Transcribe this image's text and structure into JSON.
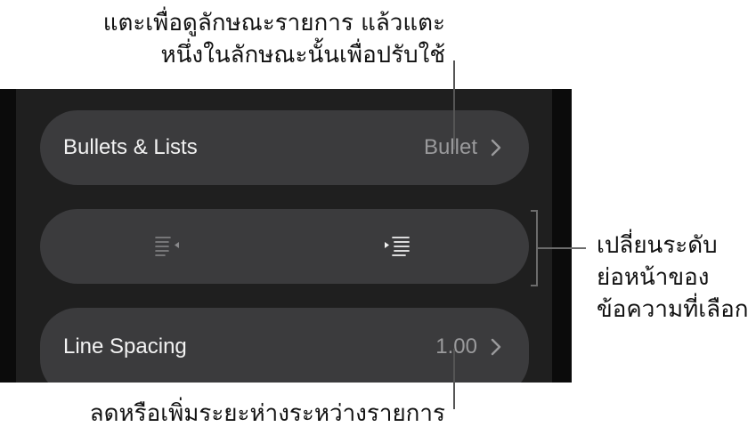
{
  "callouts": {
    "top": [
      "แตะเพื่อดูลักษณะรายการ แล้วแตะ",
      "หนึ่งในลักษณะนั้นเพื่อปรับใช้"
    ],
    "right": [
      "เปลี่ยนระดับ",
      "ย่อหน้าของ",
      "ข้อความที่เลือก"
    ],
    "bottom": "ลดหรือเพิ่มระยะห่างระหว่างรายการ"
  },
  "panel": {
    "bullets_lists": {
      "label": "Bullets & Lists",
      "value": "Bullet",
      "icon": "chevron-right-icon"
    },
    "indent": {
      "decrease_icon": "outdent-icon",
      "increase_icon": "indent-icon"
    },
    "line_spacing": {
      "label": "Line Spacing",
      "value": "1.00",
      "icon": "chevron-right-icon"
    }
  },
  "colors": {
    "panel_bg": "#1f1f1f",
    "row_bg": "#3b3b3d",
    "label_text": "#f2f2f2",
    "value_text": "#9a9a9c"
  }
}
